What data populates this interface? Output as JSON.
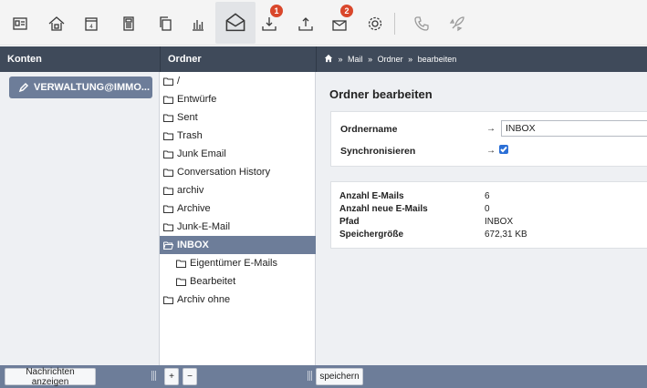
{
  "toolbar": {
    "badges": {
      "download": "1",
      "inbox_special": "2"
    },
    "icons": [
      "contacts-icon",
      "home-icon",
      "calendar-icon",
      "calculator-icon",
      "copy-icon",
      "chart-icon",
      "mail-icon",
      "download-icon",
      "upload-icon",
      "mail-badge-icon",
      "settings-icon",
      "phone-icon",
      "rocket-icon"
    ]
  },
  "header": {
    "accounts_title": "Konten",
    "folders_title": "Ordner",
    "breadcrumb": {
      "sep": "»",
      "items": [
        "Mail",
        "Ordner",
        "bearbeiten"
      ]
    }
  },
  "accounts": {
    "items": [
      {
        "label": "VERWALTUNG@IMMO..."
      }
    ]
  },
  "folders": {
    "items": [
      {
        "label": "/"
      },
      {
        "label": "Entwürfe"
      },
      {
        "label": "Sent"
      },
      {
        "label": "Trash"
      },
      {
        "label": "Junk Email"
      },
      {
        "label": "Conversation History"
      },
      {
        "label": "archiv"
      },
      {
        "label": "Archive"
      },
      {
        "label": "Junk-E-Mail"
      },
      {
        "label": "INBOX",
        "selected": true
      },
      {
        "label": "Eigentümer E-Mails"
      },
      {
        "label": "Bearbeitet"
      },
      {
        "label": "Archiv ohne"
      }
    ]
  },
  "main": {
    "title": "Ordner bearbeiten",
    "form": {
      "name_label": "Ordnername",
      "name_value": "INBOX",
      "sync_label": "Synchronisieren",
      "sync_checked": true,
      "arrow": "→"
    },
    "stats": [
      {
        "label": "Anzahl E-Mails",
        "value": "6"
      },
      {
        "label": "Anzahl neue E-Mails",
        "value": "0"
      },
      {
        "label": "Pfad",
        "value": "INBOX"
      },
      {
        "label": "Speichergröße",
        "value": "672,31 KB"
      }
    ]
  },
  "footer": {
    "show_messages": "Nachrichten anzeigen",
    "add": "+",
    "remove": "−",
    "save": "speichern"
  },
  "colors": {
    "header": "#3f4a5a",
    "accent": "#6d7d99",
    "badge": "#d9472b",
    "panel": "#eef0f3",
    "checkbox": "#2b6fd6"
  }
}
